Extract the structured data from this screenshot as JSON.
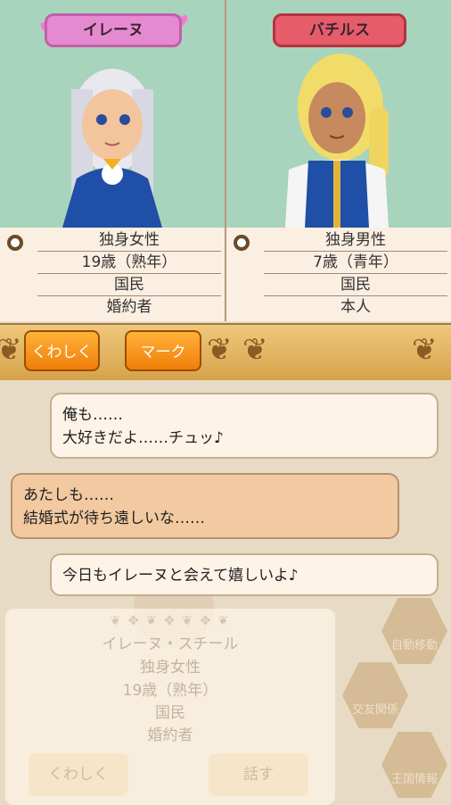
{
  "characters": [
    {
      "name": "イレーヌ",
      "info": [
        "独身女性",
        "19歳（熟年）",
        "国民",
        "婚約者"
      ]
    },
    {
      "name": "バチルス",
      "info": [
        "独身男性",
        "7歳（青年）",
        "国民",
        "本人"
      ]
    }
  ],
  "toolbar": {
    "details_label": "くわしく",
    "mark_label": "マーク"
  },
  "messages": [
    {
      "lines": [
        "俺も……",
        "大好きだよ……チュッ♪"
      ]
    },
    {
      "lines": [
        "あたしも……",
        "結婚式が待ち遠しいな……"
      ]
    },
    {
      "lines": [
        "今日もイレーヌと会えて嬉しいよ♪"
      ]
    }
  ],
  "background_card": {
    "full_name": "イレーヌ・スチール",
    "info": [
      "独身女性",
      "19歳（熟年）",
      "国民",
      "婚約者"
    ],
    "details_label": "くわしく",
    "talk_label": "話す"
  },
  "side_menu": [
    {
      "label": "自動移動",
      "icon": "auto-move-icon"
    },
    {
      "label": "交友関係",
      "icon": "friends-icon"
    },
    {
      "label": "王国情報",
      "icon": "kingdom-icon"
    }
  ],
  "colors": {
    "portrait_bg": "#a8d4bd",
    "button_orange": "#ef7e08",
    "name_tag_female": "#e58ad0",
    "name_tag_male": "#e65c6a"
  }
}
